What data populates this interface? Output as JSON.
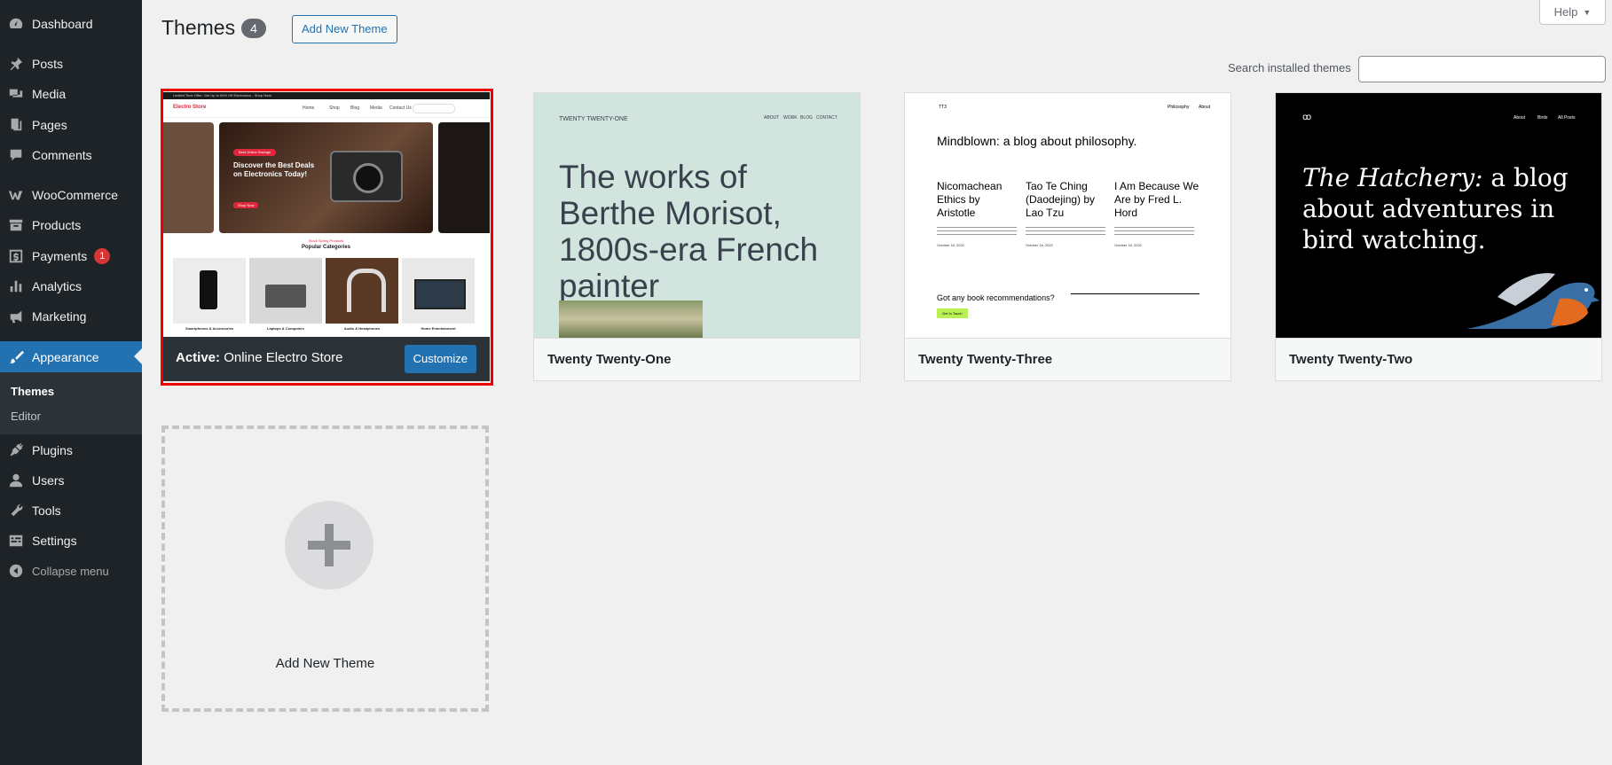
{
  "sidebar": {
    "items": [
      {
        "label": "Dashboard",
        "icon": "dashboard-icon"
      },
      {
        "label": "Posts",
        "icon": "pin-icon"
      },
      {
        "label": "Media",
        "icon": "media-icon"
      },
      {
        "label": "Pages",
        "icon": "pages-icon"
      },
      {
        "label": "Comments",
        "icon": "comment-icon"
      },
      {
        "label": "WooCommerce",
        "icon": "woocommerce-icon"
      },
      {
        "label": "Products",
        "icon": "archive-icon"
      },
      {
        "label": "Payments",
        "icon": "dollar-icon",
        "badge": "1"
      },
      {
        "label": "Analytics",
        "icon": "bar-chart-icon"
      },
      {
        "label": "Marketing",
        "icon": "megaphone-icon"
      },
      {
        "label": "Appearance",
        "icon": "paintbrush-icon"
      },
      {
        "label": "Plugins",
        "icon": "plugin-icon"
      },
      {
        "label": "Users",
        "icon": "user-icon"
      },
      {
        "label": "Tools",
        "icon": "wrench-icon"
      },
      {
        "label": "Settings",
        "icon": "settings-icon"
      }
    ],
    "submenu": {
      "themes": "Themes",
      "editor": "Editor"
    },
    "collapse_label": "Collapse menu"
  },
  "header": {
    "title": "Themes",
    "count": "4",
    "add_new_label": "Add New Theme",
    "help_label": "Help"
  },
  "search": {
    "label": "Search installed themes",
    "value": "",
    "placeholder": ""
  },
  "themes": {
    "active": {
      "prefix": "Active:",
      "name": "Online Electro Store",
      "customize_label": "Customize",
      "preview": {
        "topbar": "Limited Time Offer: Get Up to 50% Off Electronics - Shop Now!",
        "logo": "Electro Store",
        "nav": [
          "Home",
          "Shop",
          "Blog",
          "Media",
          "Contact Us"
        ],
        "hero_badge": "Best Online Savings",
        "hero_title": "Discover the Best Deals on Electronics Today!",
        "hero_button": "Shop Now",
        "section_kicker": "Stock Spring Products",
        "section_title": "Popular Categories",
        "categories": [
          "Smartphones & Accessories",
          "Laptops & Computers",
          "Audio & Headphones",
          "Home Entertainment"
        ]
      }
    },
    "others": [
      {
        "name": "Twenty Twenty-One",
        "preview": {
          "site": "TWENTY TWENTY-ONE",
          "nav": [
            "ABOUT",
            "WORK",
            "BLOG",
            "CONTACT"
          ],
          "headline": "The works of Berthe Morisot, 1800s-era French painter"
        }
      },
      {
        "name": "Twenty Twenty-Three",
        "preview": {
          "site": "TT3",
          "nav": [
            "Philosophy",
            "About"
          ],
          "headline": "Mindblown: a blog about philosophy.",
          "posts": [
            "Nicomachean Ethics by Aristotle",
            "Tao Te Ching (Daodejing) by Lao Tzu",
            "I Am Because We Are by Fred L. Hord"
          ],
          "date": "October 16, 2022",
          "cta": "Got any book recommendations?",
          "cta_button": "Get In Touch"
        }
      },
      {
        "name": "Twenty Twenty-Two",
        "preview": {
          "nav": [
            "About",
            "Birds",
            "All Posts"
          ],
          "headline_em": "The Hatchery:",
          "headline_rest": " a blog about adventures in bird watching."
        }
      }
    ]
  },
  "add_new_card": {
    "label": "Add New Theme"
  },
  "colors": {
    "accent": "#2271b1",
    "sidebar": "#1d2327",
    "active_frame": "#ee0000",
    "badge": "#d63638"
  }
}
